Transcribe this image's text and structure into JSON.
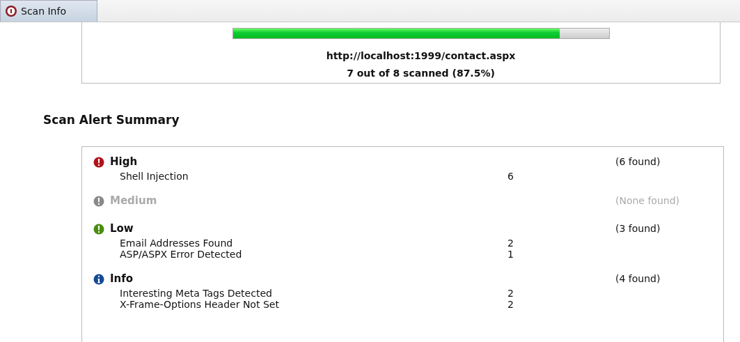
{
  "tab": {
    "label": "Scan Info",
    "selected": true
  },
  "progress": {
    "level": 0.87,
    "url": "http://localhost:1999/contact.aspx",
    "status": "7 out of 8 scanned (87.5%)"
  },
  "summary_title": "Scan Alert Summary",
  "severities": [
    {
      "kind": "high",
      "label": "High",
      "found": "(6 found)",
      "muted": false,
      "alerts": [
        {
          "name": "Shell Injection",
          "count": "6"
        }
      ]
    },
    {
      "kind": "medium",
      "label": "Medium",
      "found": "(None found)",
      "muted": true
    },
    {
      "kind": "low",
      "label": "Low",
      "found": "(3 found)",
      "muted": false,
      "alerts": [
        {
          "name": "Email Addresses Found",
          "count": "2"
        },
        {
          "name": "ASP/ASPX Error Detected",
          "count": "1"
        }
      ]
    },
    {
      "kind": "info",
      "label": "Info",
      "found": "(4 found)",
      "muted": false,
      "alerts": [
        {
          "name": "Interesting Meta Tags Detected",
          "count": "2"
        },
        {
          "name": "X-Frame-Options Header Not Set",
          "count": "2"
        }
      ]
    }
  ]
}
